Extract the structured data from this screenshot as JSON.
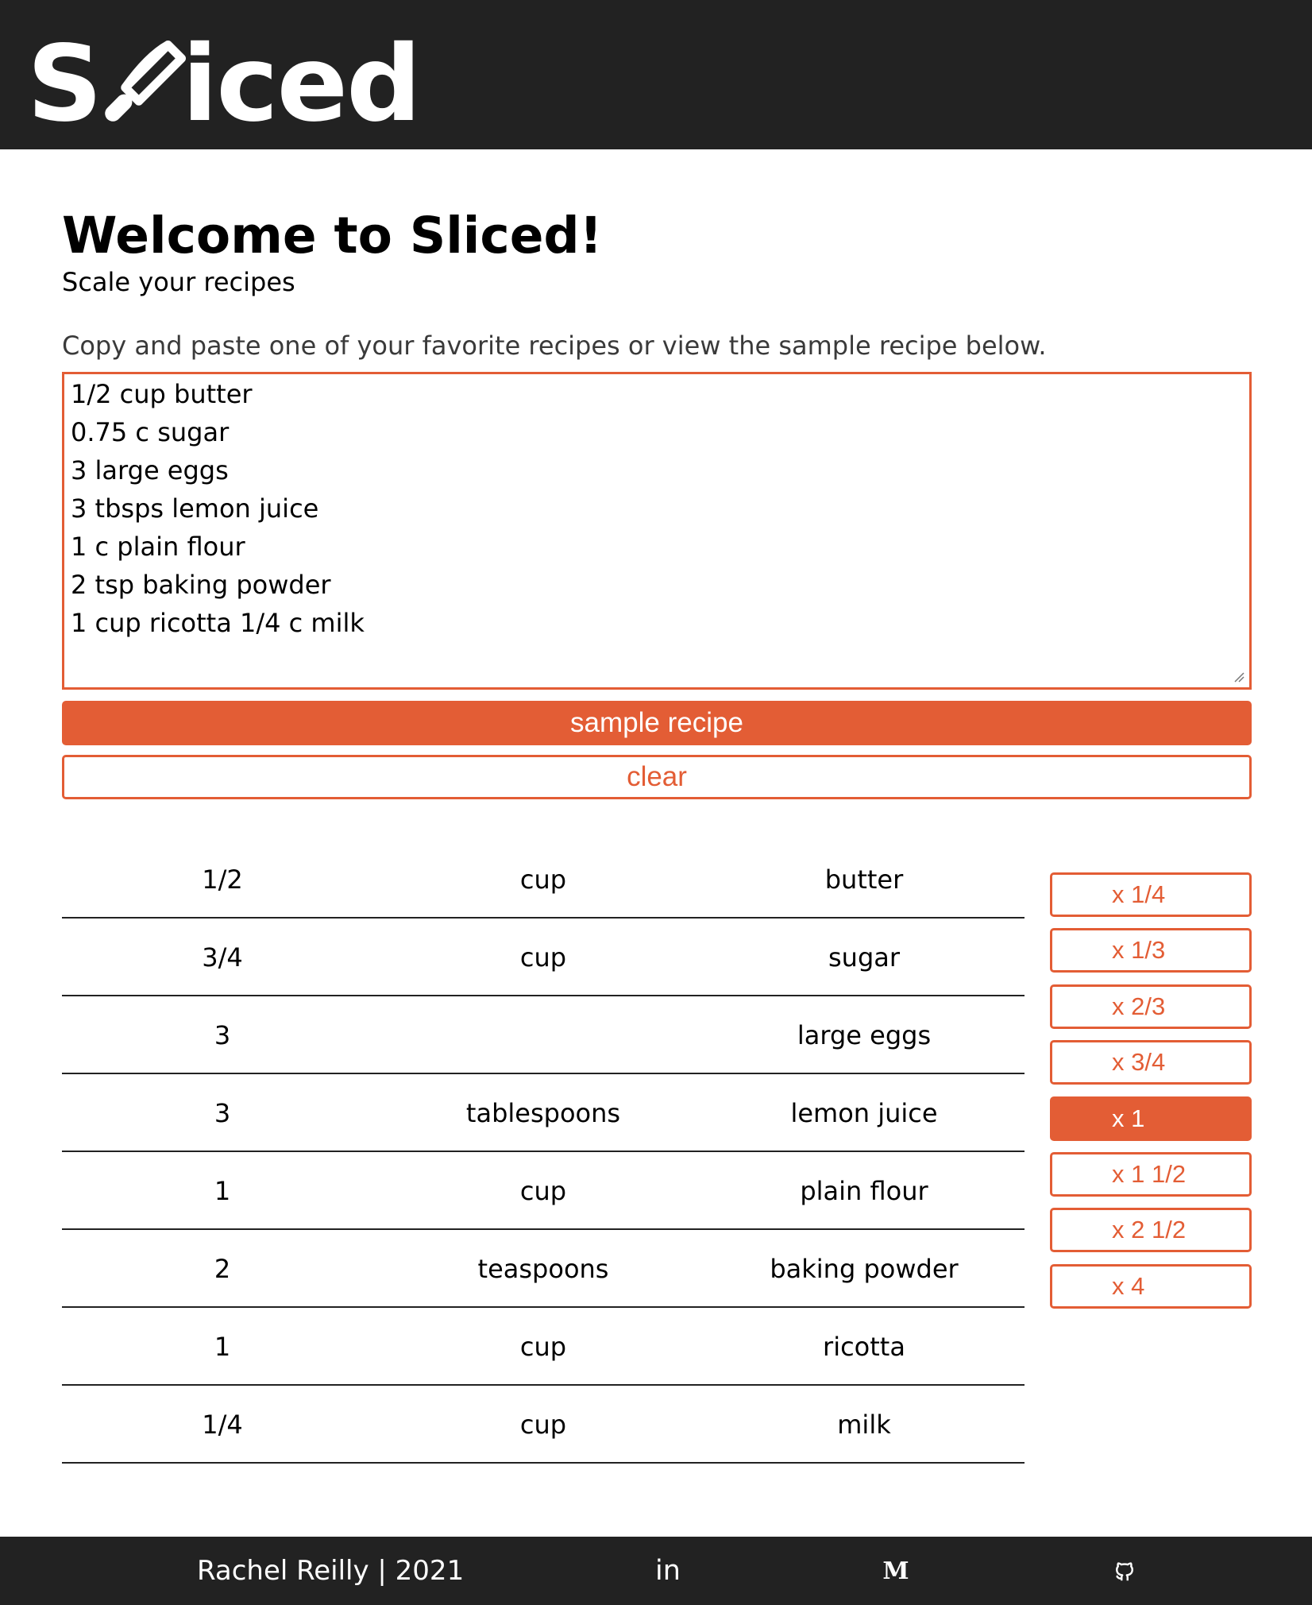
{
  "app": {
    "logo_text_start": "S",
    "logo_text_end": "iced",
    "logo_word": "Sliced"
  },
  "colors": {
    "accent": "#e35d35",
    "header_bg": "#222222",
    "text": "#000000"
  },
  "main": {
    "title": "Welcome to Sliced!",
    "subtitle": "Scale your recipes",
    "instructions": "Copy and paste one of your favorite recipes or view the sample recipe below."
  },
  "recipe_input": {
    "lines": [
      "1/2 cup butter",
      "0.75 c sugar",
      "3 large eggs",
      "3 tbsps lemon juice",
      "1 c plain flour",
      "2 tsp baking powder",
      "1 cup ricotta 1/4 c milk"
    ]
  },
  "buttons": {
    "sample": "sample recipe",
    "clear": "clear"
  },
  "ingredients": [
    {
      "quantity": "1/2",
      "unit": "cup",
      "name": "butter"
    },
    {
      "quantity": "3/4",
      "unit": "cup",
      "name": "sugar"
    },
    {
      "quantity": "3",
      "unit": "",
      "name": "large eggs"
    },
    {
      "quantity": "3",
      "unit": "tablespoons",
      "name": "lemon juice"
    },
    {
      "quantity": "1",
      "unit": "cup",
      "name": "plain flour"
    },
    {
      "quantity": "2",
      "unit": "teaspoons",
      "name": "baking powder"
    },
    {
      "quantity": "1",
      "unit": "cup",
      "name": "ricotta"
    },
    {
      "quantity": "1/4",
      "unit": "cup",
      "name": "milk"
    }
  ],
  "scale_options": [
    {
      "label": "x 1/4",
      "active": false
    },
    {
      "label": "x 1/3",
      "active": false
    },
    {
      "label": "x 2/3",
      "active": false
    },
    {
      "label": "x 3/4",
      "active": false
    },
    {
      "label": "x 1",
      "active": true
    },
    {
      "label": "x 1 1/2",
      "active": false
    },
    {
      "label": "x 2 1/2",
      "active": false
    },
    {
      "label": "x 4",
      "active": false
    }
  ],
  "footer": {
    "credit": "Rachel Reilly | 2021",
    "linkedin_glyph": "in",
    "medium_glyph": "M",
    "icons": [
      "linkedin-icon",
      "medium-icon",
      "github-icon"
    ]
  }
}
